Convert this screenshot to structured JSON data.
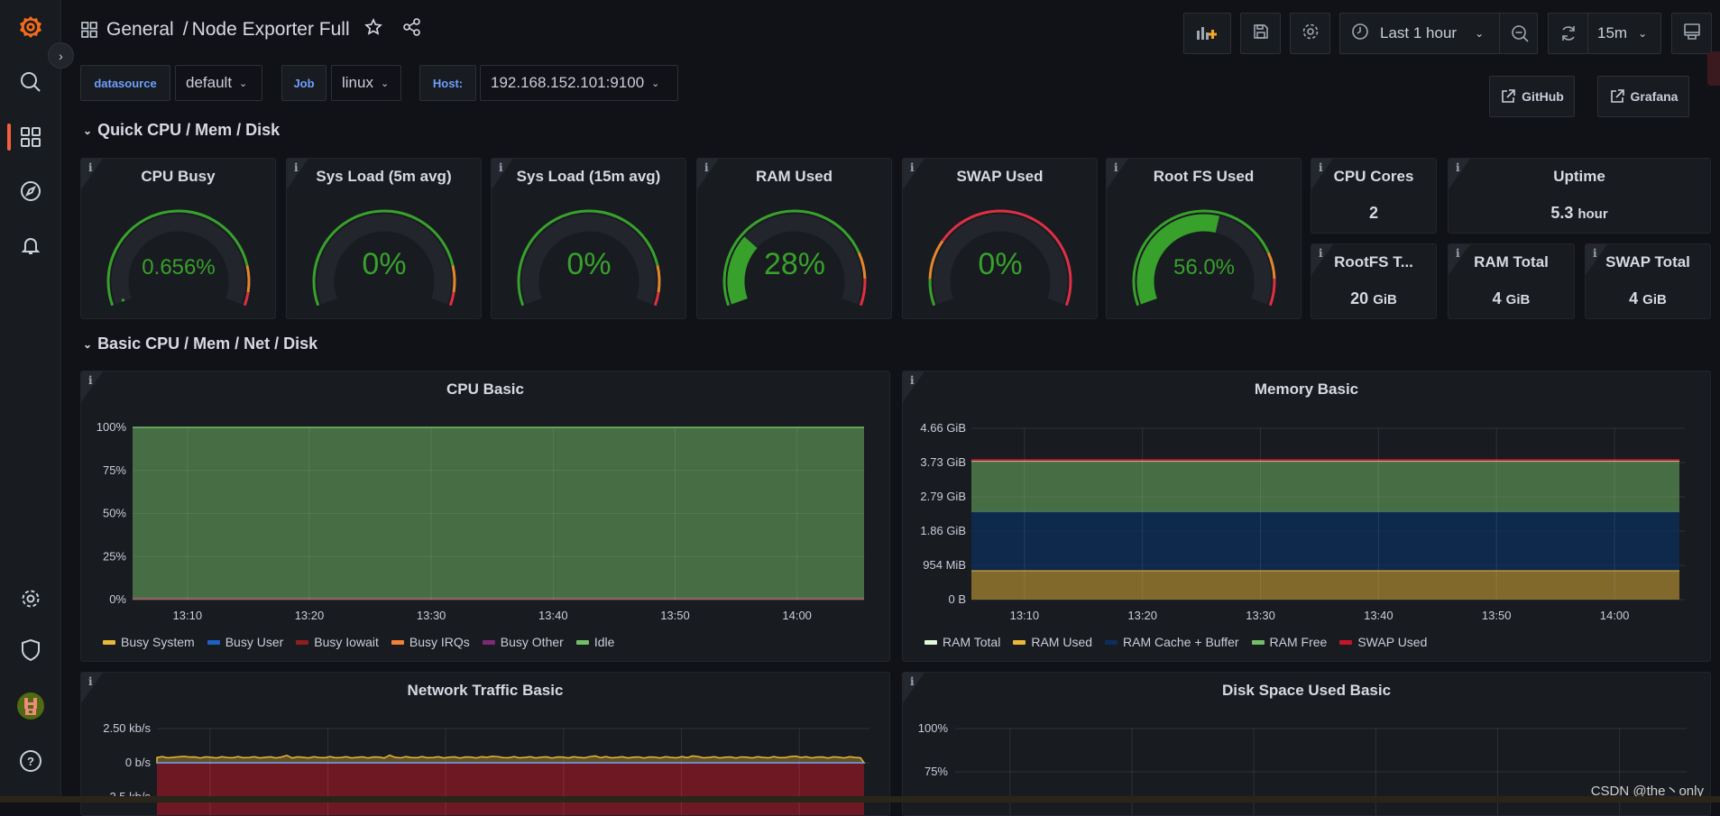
{
  "header": {
    "breadcrumb_folder": "General",
    "breadcrumb_sep": "/",
    "dashboard_title": "Node Exporter Full",
    "time_range": "Last 1 hour",
    "refresh_interval": "15m"
  },
  "variables": [
    {
      "label": "datasource",
      "value": "default"
    },
    {
      "label": "Job",
      "value": "linux"
    },
    {
      "label": "Host:",
      "value": "192.168.152.101:9100"
    }
  ],
  "links": [
    {
      "label": "GitHub"
    },
    {
      "label": "Grafana"
    }
  ],
  "rows": [
    {
      "title": "Quick CPU / Mem / Disk"
    },
    {
      "title": "Basic CPU / Mem / Net / Disk"
    }
  ],
  "colors": {
    "green": "#37a12c",
    "orange": "#e5862c",
    "red": "#e02f44",
    "track": "#22252b"
  },
  "gauges": [
    {
      "title": "CPU Busy",
      "value": 0.656,
      "display": "0.656%",
      "thresholds": [
        85,
        95
      ]
    },
    {
      "title": "Sys Load (5m avg)",
      "value": 0,
      "display": "0%",
      "thresholds": [
        85,
        95
      ]
    },
    {
      "title": "Sys Load (15m avg)",
      "value": 0,
      "display": "0%",
      "thresholds": [
        85,
        95
      ]
    },
    {
      "title": "RAM Used",
      "value": 28,
      "display": "28%",
      "thresholds": [
        80,
        90
      ]
    },
    {
      "title": "SWAP Used",
      "value": 0,
      "display": "0%",
      "thresholds": [
        10,
        25
      ]
    },
    {
      "title": "Root FS Used",
      "value": 56.0,
      "display": "56.0%",
      "thresholds": [
        80,
        90
      ]
    }
  ],
  "stats": [
    {
      "title": "CPU Cores",
      "value": "2",
      "unit": ""
    },
    {
      "title": "Uptime",
      "value": "5.3",
      "unit": "hour"
    },
    {
      "title": "RootFS T...",
      "value": "20",
      "unit": "GiB"
    },
    {
      "title": "RAM Total",
      "value": "4",
      "unit": "GiB"
    },
    {
      "title": "SWAP Total",
      "value": "4",
      "unit": "GiB"
    }
  ],
  "chart_data": [
    {
      "title": "CPU Basic",
      "type": "area",
      "stacked": true,
      "x_ticks": [
        "13:10",
        "13:20",
        "13:30",
        "13:40",
        "13:50",
        "14:00"
      ],
      "xlim": [
        "13:05:30",
        "14:05:30"
      ],
      "y_ticks": [
        "0%",
        "25%",
        "50%",
        "75%",
        "100%"
      ],
      "ylim": [
        0,
        100
      ],
      "grid": true,
      "legend": "bottom",
      "series": [
        {
          "name": "Busy System",
          "color": "#eab839",
          "value": 0.3
        },
        {
          "name": "Busy User",
          "color": "#1f60c4",
          "value": 0.3
        },
        {
          "name": "Busy Iowait",
          "color": "#8f1e1e",
          "value": 0.1
        },
        {
          "name": "Busy IRQs",
          "color": "#f2813a",
          "value": 0
        },
        {
          "name": "Busy Other",
          "color": "#7d2a76",
          "value": 0
        },
        {
          "name": "Idle",
          "color": "#73bf69",
          "value": 99.3
        }
      ]
    },
    {
      "title": "Memory Basic",
      "type": "area",
      "stacked": true,
      "x_ticks": [
        "13:10",
        "13:20",
        "13:30",
        "13:40",
        "13:50",
        "14:00"
      ],
      "xlim": [
        "13:05:30",
        "14:05:30"
      ],
      "y_ticks": [
        "0 B",
        "954 MiB",
        "1.86 GiB",
        "2.79 GiB",
        "3.73 GiB",
        "4.66 GiB"
      ],
      "ylim_gib": [
        0,
        4.66
      ],
      "grid": true,
      "legend": "bottom",
      "series": [
        {
          "name": "RAM Total",
          "color": "#e0f9d7",
          "value_gib": 3.77,
          "style": "line"
        },
        {
          "name": "RAM Used",
          "color": "#eab839",
          "value_gib": 0.79
        },
        {
          "name": "RAM Cache + Buffer",
          "color": "#0a2f5e",
          "value_gib": 1.59
        },
        {
          "name": "RAM Free",
          "color": "#73bf69",
          "value_gib": 1.39
        },
        {
          "name": "SWAP Used",
          "color": "#c4162a",
          "value_gib": 0,
          "style": "line"
        }
      ]
    },
    {
      "title": "Network Traffic Basic",
      "type": "area",
      "y_ticks": [
        "2.50 kb/s",
        "0 b/s",
        "-2.5 kb/s"
      ],
      "ylim_kbps": [
        -2.5,
        2.5
      ],
      "grid": true,
      "series": [
        {
          "color": "#eab839",
          "value": 0.4
        },
        {
          "color": "#c4162a",
          "value": -2.5
        }
      ]
    },
    {
      "title": "Disk Space Used Basic",
      "type": "line",
      "y_ticks": [
        "75%",
        "100%"
      ],
      "ylim": [
        75,
        100
      ],
      "grid": true,
      "series": []
    }
  ],
  "watermark": "CSDN @the丶only"
}
